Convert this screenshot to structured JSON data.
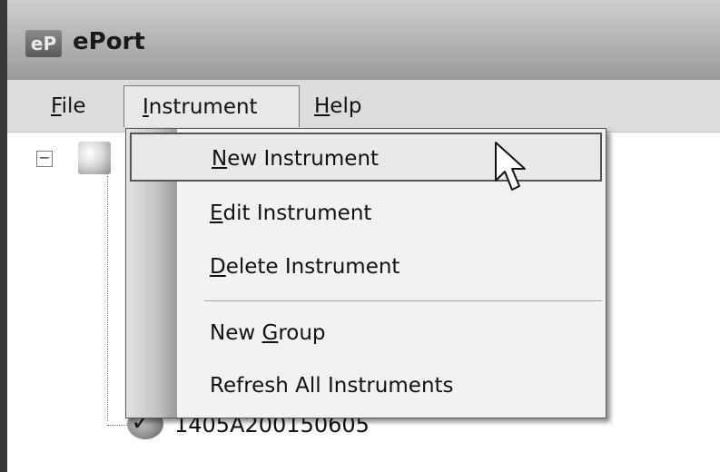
{
  "window": {
    "title": "ePort",
    "icon_text": "eP"
  },
  "menubar": {
    "items": [
      {
        "label_pre": "",
        "label_ul": "F",
        "label_post": "ile"
      },
      {
        "label_pre": "",
        "label_ul": "I",
        "label_post": "nstrument"
      },
      {
        "label_pre": "",
        "label_ul": "H",
        "label_post": "elp"
      }
    ]
  },
  "dropdown": {
    "items": [
      {
        "label_pre": "",
        "label_ul": "N",
        "label_post": "ew Instrument",
        "highlighted": true
      },
      {
        "label_pre": "",
        "label_ul": "E",
        "label_post": "dit Instrument"
      },
      {
        "label_pre": "",
        "label_ul": "D",
        "label_post": "elete Instrument"
      },
      {
        "label_pre": "New ",
        "label_ul": "G",
        "label_post": "roup"
      },
      {
        "label_pre": "Refresh All Instruments",
        "label_ul": "",
        "label_post": ""
      }
    ]
  },
  "tree": {
    "toggle_symbol": "−",
    "device_label": "1405A200150605",
    "check_symbol": "✓"
  },
  "icons": [
    "app-icon",
    "tree-collapse-icon",
    "instrument-root-icon",
    "device-status-icon",
    "checkmark-icon",
    "mouse-cursor-icon"
  ]
}
